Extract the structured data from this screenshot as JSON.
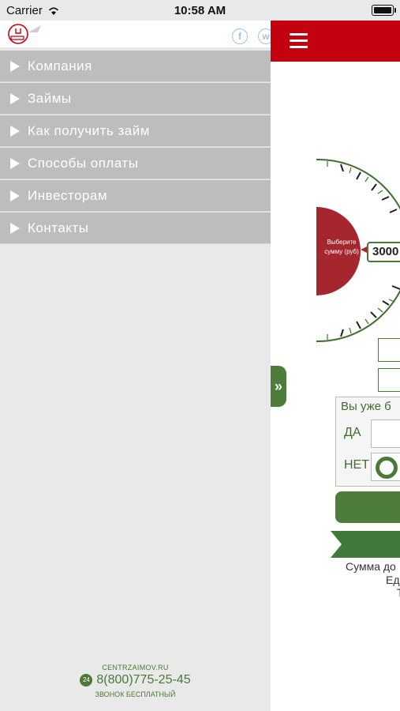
{
  "status_bar": {
    "carrier": "Carrier",
    "time": "10:58 AM"
  },
  "drawer": {
    "social": {
      "facebook": "f",
      "vk": "w"
    },
    "menu": [
      {
        "label": "Компания"
      },
      {
        "label": "Займы"
      },
      {
        "label": "Как получить займ"
      },
      {
        "label": "Способы оплаты"
      },
      {
        "label": "Инвесторам"
      },
      {
        "label": "Контакты"
      }
    ],
    "footer": {
      "site": "CENTRZAIMOV.RU",
      "phone": "8(800)775-25-45",
      "phone_badge": "24",
      "note": "ЗВОНОК БЕСПЛАТНЫЙ"
    }
  },
  "toggle_tab": {
    "glyph": "»"
  },
  "main": {
    "selector": {
      "prompt": "Выберите сумму (руб)",
      "amount": "3000"
    },
    "question": {
      "text": "Вы уже б",
      "yes_label": "ДА",
      "no_label": "НЕТ"
    },
    "description": {
      "line1": "Сумма до",
      "line2": "Ед",
      "line3": "Т"
    }
  },
  "colors": {
    "brand_red": "#c3020f",
    "brand_green": "#4e7c3a",
    "menu_gray": "#bdbdbd",
    "gauge_red": "#a5262d"
  }
}
